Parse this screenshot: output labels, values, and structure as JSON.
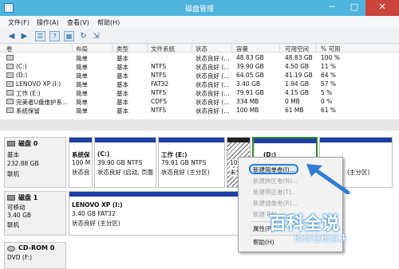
{
  "window": {
    "title": "磁盘管理",
    "min": "─",
    "max": "□",
    "close": "✕"
  },
  "menu": [
    "文件(F)",
    "操作(A)",
    "查看(V)",
    "帮助(H)"
  ],
  "toolbar": [
    "back-icon",
    "forward-icon",
    "list-icon",
    "help-icon",
    "properties-icon",
    "refresh-icon",
    "export-icon"
  ],
  "volume_table": {
    "columns": [
      "卷",
      "布局",
      "类型",
      "文件系统",
      "状态",
      "容量",
      "可用空间",
      "% 可用"
    ],
    "rows": [
      [
        "",
        "简单",
        "基本",
        "",
        "状态良好 (...",
        "48.83 GB",
        "48.83 GB",
        "100 %"
      ],
      [
        "(C:)",
        "简单",
        "基本",
        "NTFS",
        "状态良好 (...",
        "39.90 GB",
        "4.50 GB",
        "11 %"
      ],
      [
        "(D:)",
        "简单",
        "基本",
        "NTFS",
        "状态良好 (...",
        "64.05 GB",
        "41.19 GB",
        "64 %"
      ],
      [
        "LENOVO XP (I:)",
        "简单",
        "基本",
        "FAT32",
        "状态良好 (...",
        "3.40 GB",
        "1.94 GB",
        "57 %"
      ],
      [
        "工作 (E:)",
        "简单",
        "基本",
        "NTFS",
        "状态良好 (...",
        "79.91 GB",
        "4.15 GB",
        "5 %"
      ],
      [
        "完美者U盘维护系...",
        "简单",
        "基本",
        "CDFS",
        "状态良好 (...",
        "334 MB",
        "0 MB",
        "0 %"
      ],
      [
        "系统保留",
        "简单",
        "基本",
        "NTFS",
        "状态良好 (...",
        "100 MB",
        "61 MB",
        "61 %"
      ]
    ]
  },
  "disks": [
    {
      "name": "磁盘 0",
      "lines": [
        "基本",
        "232.88 GB",
        "联机"
      ],
      "partitions": [
        {
          "name": "系统保",
          "lines": [
            "100 M",
            "状态良"
          ]
        },
        {
          "name": "(C:)",
          "lines": [
            "39.90 GB NTFS",
            "状态良好 (启动, 页面"
          ]
        },
        {
          "name": "工作 (E:)",
          "lines": [
            "79.91 GB NTFS",
            "状态良好 (主分区)"
          ]
        },
        {
          "name": "",
          "lines": [
            "100",
            "未分"
          ]
        },
        {
          "name": "(D:)",
          "lines": [
            "",
            ""
          ]
        },
        {
          "name": "",
          "lines": [
            "",
            "(主分区)"
          ]
        }
      ]
    },
    {
      "name": "磁盘 1",
      "lines": [
        "可移动",
        "3.40 GB",
        "联机"
      ],
      "partitions": [
        {
          "name": "LENOVO XP (I:)",
          "lines": [
            "3.40 GB FAT32",
            "状态良好 (主分区)"
          ]
        }
      ]
    },
    {
      "name": "CD-ROM 0",
      "lines": [
        "DVD (F:)"
      ],
      "partitions": []
    }
  ],
  "context_menu": {
    "items": [
      {
        "label": "新建简单卷(I)...",
        "enabled": true
      },
      {
        "label": "新建跨区卷(N)...",
        "enabled": false
      },
      {
        "label": "新建带区卷(T)...",
        "enabled": false
      },
      {
        "label": "新建镜像卷(R)...",
        "enabled": false
      },
      {
        "label": "新建 RAI",
        "enabled": false
      },
      {
        "label": "属性(P)",
        "enabled": true
      },
      {
        "label": "帮助(H)",
        "enabled": true
      }
    ]
  },
  "watermark": {
    "title": "百科全说",
    "subtitle": "助你轻松解决"
  },
  "colors": {
    "titlebar": "#4fb4de",
    "partition_bar": "#1e3fa6",
    "unallocated_hatch": "#5f5f5f",
    "selected_border": "#2a8a2a",
    "highlight": "#2f7cd8"
  }
}
